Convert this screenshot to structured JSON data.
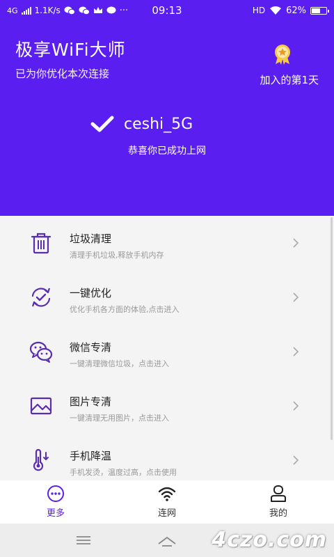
{
  "status_bar": {
    "network": "4G",
    "speed": "1.1K/s",
    "time": "09:13",
    "hd": "HD",
    "battery": "62%",
    "battery_level": 0.62,
    "more": "···"
  },
  "header": {
    "title": "极享WiFi大师",
    "subtitle": "已为你优化本次连接",
    "days_joined": "加入的第1天"
  },
  "connection": {
    "ssid": "ceshi_5G",
    "message": "恭喜你已成功上网"
  },
  "features": [
    {
      "title": "垃圾清理",
      "desc": "清理手机垃圾,释放手机内存",
      "icon": "trash-icon"
    },
    {
      "title": "一键优化",
      "desc": "优化手机各方面的体验,点击进入",
      "icon": "optimize-icon"
    },
    {
      "title": "微信专清",
      "desc": "一键清理微信垃圾，点击进入",
      "icon": "wechat-icon"
    },
    {
      "title": "图片专清",
      "desc": "一键清理无用图片，点击进入",
      "icon": "image-icon"
    },
    {
      "title": "手机降温",
      "desc": "手机发烫，温度过高，点击使用",
      "icon": "thermometer-icon"
    }
  ],
  "tabs": [
    {
      "label": "更多",
      "icon": "more-icon",
      "active": true
    },
    {
      "label": "连网",
      "icon": "wifi-icon",
      "active": false
    },
    {
      "label": "我的",
      "icon": "user-icon",
      "active": false
    }
  ],
  "watermark": "4czo.com",
  "colors": {
    "brand": "#5a1ff0",
    "background": "#f4f4f4",
    "icon": "#5a2db0"
  }
}
